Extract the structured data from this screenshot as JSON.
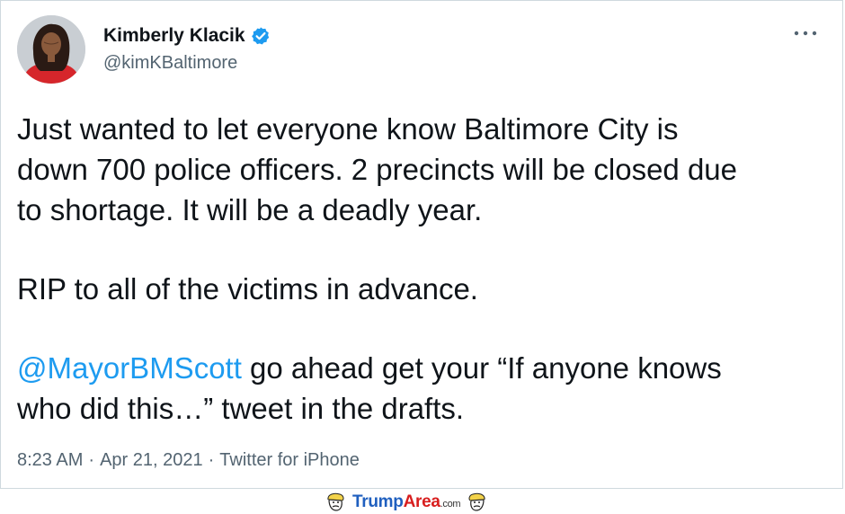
{
  "tweet": {
    "author": {
      "display_name": "Kimberly Klacik",
      "handle": "@kimKBaltimore",
      "verified": true,
      "avatar_icon": "profile-photo"
    },
    "more_icon": "more-horizontal-icon",
    "text": {
      "paragraph_1_lines": [
        "Just wanted to let everyone know Baltimore City is",
        "down 700 police officers. 2 precincts will be closed due",
        "to shortage. It will be a deadly year."
      ],
      "paragraph_2": "RIP to all of the victims in advance.",
      "paragraph_3": {
        "mention": "@MayorBMScott",
        "line_1_rest": " go ahead get your “If anyone knows",
        "line_2": "who did this…” tweet in the drafts."
      }
    },
    "meta": {
      "time": "8:23 AM",
      "separator": "·",
      "date": "Apr 21, 2021",
      "source": "Twitter for iPhone"
    }
  },
  "watermark": {
    "part_1": "Trump",
    "part_2": "Area",
    "part_3": ".com"
  },
  "colors": {
    "link": "#1d9bf0",
    "secondary_text": "#536471",
    "primary_text": "#0f1419",
    "verified_badge": "#1d9bf0",
    "watermark_blue": "#1f5fbf",
    "watermark_red": "#d81e1e"
  }
}
